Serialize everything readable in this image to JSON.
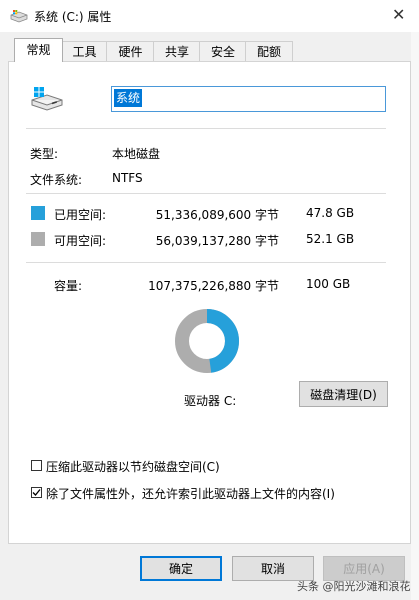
{
  "window": {
    "title": "系统 (C:) 属性",
    "close_glyph": "✕"
  },
  "tabs": [
    {
      "label": "常规",
      "active": true
    },
    {
      "label": "工具",
      "active": false
    },
    {
      "label": "硬件",
      "active": false
    },
    {
      "label": "共享",
      "active": false
    },
    {
      "label": "安全",
      "active": false
    },
    {
      "label": "配额",
      "active": false
    }
  ],
  "general": {
    "drive_name": "系统",
    "type_label": "类型:",
    "type_value": "本地磁盘",
    "fs_label": "文件系统:",
    "fs_value": "NTFS",
    "used": {
      "label": "已用空间:",
      "bytes": "51,336,089,600 字节",
      "size": "47.8 GB",
      "color": "#26a0da"
    },
    "free": {
      "label": "可用空间:",
      "bytes": "56,039,137,280 字节",
      "size": "52.1 GB",
      "color": "#adadad"
    },
    "capacity": {
      "label": "容量:",
      "bytes": "107,375,226,880 字节",
      "size": "100 GB"
    },
    "usage_fraction": 0.478,
    "drive_label": "驱动器 C:",
    "cleanup_button": "磁盘清理(D)",
    "compress_label": "压缩此驱动器以节约磁盘空间(C)",
    "compress_checked": false,
    "index_label": "除了文件属性外，还允许索引此驱动器上文件的内容(I)",
    "index_checked": true
  },
  "buttons": {
    "ok": "确定",
    "cancel": "取消",
    "apply": "应用(A)"
  },
  "watermark": "头条 @阳光沙滩和浪花"
}
